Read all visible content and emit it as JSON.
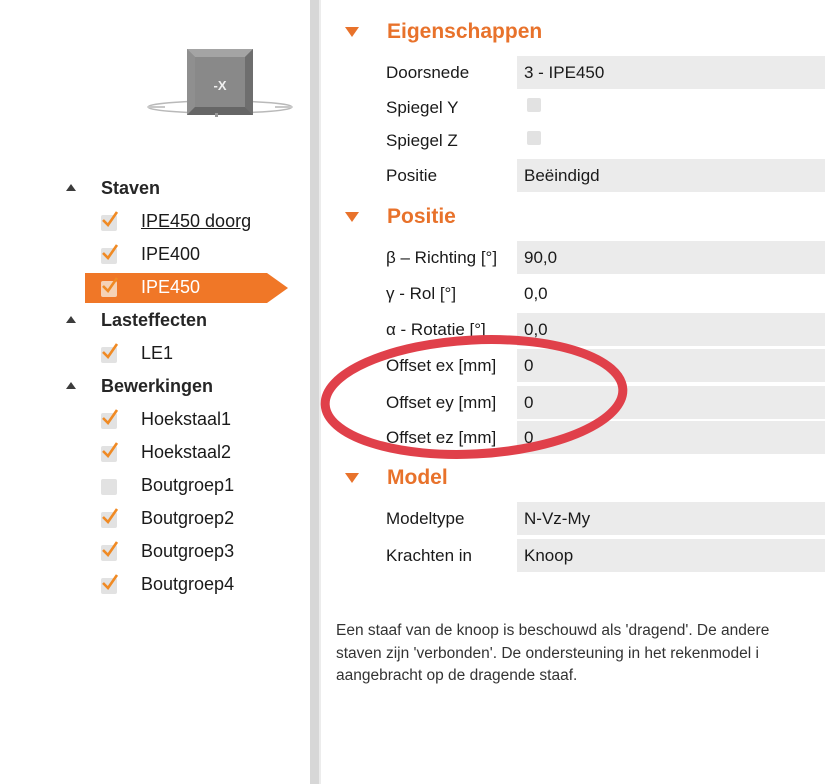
{
  "viewcube": {
    "face_label": "-X"
  },
  "tree": {
    "groups": [
      {
        "label": "Staven",
        "items": [
          {
            "label": "IPE450 doorg",
            "checked": true
          },
          {
            "label": "IPE400",
            "checked": true
          },
          {
            "label": "IPE450",
            "checked": true,
            "selected": true
          }
        ]
      },
      {
        "label": "Lasteffecten",
        "items": [
          {
            "label": "LE1",
            "checked": true
          }
        ]
      },
      {
        "label": "Bewerkingen",
        "items": [
          {
            "label": "Hoekstaal1",
            "checked": true
          },
          {
            "label": "Hoekstaal2",
            "checked": true
          },
          {
            "label": "Boutgroep1",
            "checked": false
          },
          {
            "label": "Boutgroep2",
            "checked": true
          },
          {
            "label": "Boutgroep3",
            "checked": true
          },
          {
            "label": "Boutgroep4",
            "checked": true
          }
        ]
      }
    ]
  },
  "sections": {
    "eigenschappen": {
      "title": "Eigenschappen",
      "doorsnede": {
        "label": "Doorsnede",
        "value": "3 - IPE450"
      },
      "spiegel_y": {
        "label": "Spiegel Y",
        "checked": false
      },
      "spiegel_z": {
        "label": "Spiegel Z",
        "checked": false
      },
      "positie": {
        "label": "Positie",
        "value": "Beëindigd"
      }
    },
    "positie": {
      "title": "Positie",
      "rows": [
        {
          "label": "β – Richting [°]",
          "value": "90,0"
        },
        {
          "label": "γ - Rol [°]",
          "value": "0,0"
        },
        {
          "label": "α - Rotatie [°]",
          "value": "0,0"
        },
        {
          "label": "Offset ex [mm]",
          "value": "0"
        },
        {
          "label": "Offset ey [mm]",
          "value": "0"
        },
        {
          "label": "Offset ez [mm]",
          "value": "0"
        }
      ]
    },
    "model": {
      "title": "Model",
      "modeltype": {
        "label": "Modeltype",
        "value": "N-Vz-My"
      },
      "krachten": {
        "label": "Krachten in",
        "value": "Knoop"
      }
    }
  },
  "description": [
    "Een staaf van de knoop is beschouwd als 'dragend'. De andere",
    "staven zijn 'verbonden'. De ondersteuning in het rekenmodel i",
    "aangebracht op de dragende staaf."
  ],
  "colors": {
    "accent": "#f07727",
    "section_title": "#e8722b",
    "annotation_ring": "#e0404a",
    "field_bg": "#ebebeb"
  },
  "icons": {
    "tree_check": "checkmark-icon",
    "group_toggle": "triangle-up-icon",
    "section_toggle": "triangle-down-icon"
  }
}
